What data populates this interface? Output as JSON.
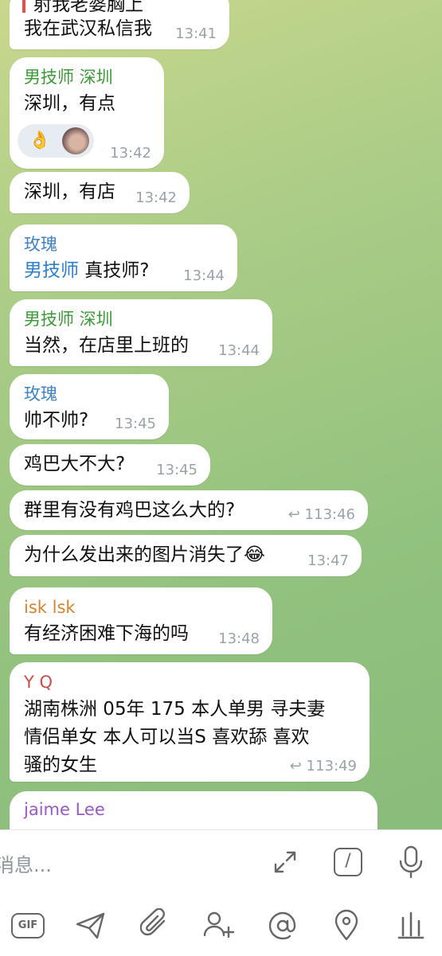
{
  "messages": [
    {
      "text": "射我老婆胸上"
    },
    {
      "text": "我在武汉私信我",
      "time": "13:41"
    },
    {
      "sender": "男技师 深圳",
      "text": "深圳，有点",
      "time": "13:42",
      "reaction": "👌"
    },
    {
      "text": "深圳，有店",
      "time": "13:42"
    },
    {
      "sender": "玫瑰",
      "mention": "男技师",
      "text": " 真技师?",
      "time": "13:44"
    },
    {
      "sender": "男技师 深圳",
      "text": "当然，在店里上班的",
      "time": "13:44"
    },
    {
      "sender": "玫瑰",
      "text": "帅不帅?",
      "time": "13:45"
    },
    {
      "text": "鸡巴大不大?",
      "time": "13:45"
    },
    {
      "text": "群里有没有鸡巴这么大的?",
      "replies": "1",
      "time": "13:46"
    },
    {
      "text": "为什么发出来的图片消失了😂",
      "time": "13:47"
    },
    {
      "sender": "isk lsk",
      "text": "有经济困难下海的吗",
      "time": "13:48"
    },
    {
      "sender": "Y Q",
      "lines": [
        "湖南株洲 05年 175 本人单男 寻夫妻",
        "情侣单女 本人可以当S 喜欢舔 喜欢",
        "骚的女生"
      ],
      "replies": "1",
      "time": "13:49"
    },
    {
      "sender": "jaime Lee"
    }
  ],
  "composer": {
    "placeholder": "消息...",
    "gif_label": "GIF",
    "command_label": "/"
  },
  "icons": {
    "expand": "expand-icon",
    "commands": "slash-command-icon",
    "mic": "microphone-icon",
    "gif": "gif-icon",
    "send": "paper-plane-icon",
    "attach": "paperclip-icon",
    "contact": "add-contact-icon",
    "mention": "at-sign-icon",
    "location": "location-pin-icon",
    "poll": "poll-icon"
  },
  "colors": {
    "sender_green": "#3c9a36",
    "sender_blue": "#3d82c4",
    "sender_orange": "#d6822c",
    "sender_red": "#cf4b4b",
    "sender_purple": "#9a59c4",
    "mention_link": "#2a7fcf"
  }
}
